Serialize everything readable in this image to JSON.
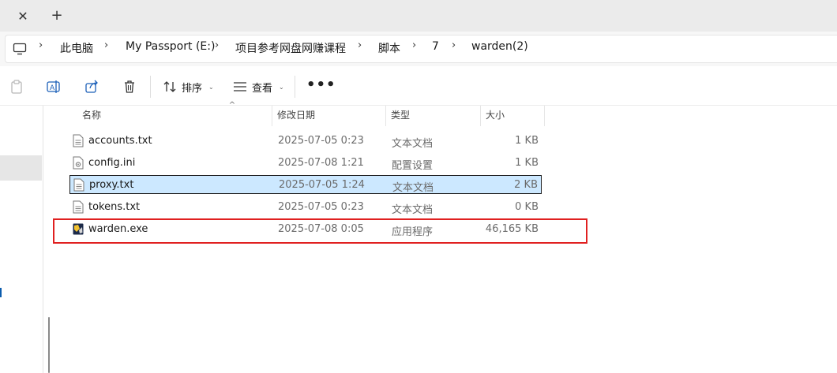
{
  "tabstrip": {
    "close_glyph": "✕",
    "new_tab_glyph": "+"
  },
  "breadcrumb": {
    "items": [
      "此电脑",
      "My Passport (E:)",
      "项目参考网盘网赚课程",
      "脚本",
      "7",
      "warden(2)"
    ]
  },
  "toolbar": {
    "sort_label": "排序",
    "view_label": "查看",
    "more_label": "•••"
  },
  "columns": {
    "name": "名称",
    "date": "修改日期",
    "type": "类型",
    "size": "大小",
    "sort_indicator": "^"
  },
  "files": [
    {
      "name": "accounts.txt",
      "date": "2025-07-05 0:23",
      "type": "文本文档",
      "size": "1 KB",
      "icon": "text-file-icon"
    },
    {
      "name": "config.ini",
      "date": "2025-07-08 1:21",
      "type": "配置设置",
      "size": "1 KB",
      "icon": "settings-file-icon"
    },
    {
      "name": "proxy.txt",
      "date": "2025-07-05 1:24",
      "type": "文本文档",
      "size": "2 KB",
      "icon": "text-file-icon",
      "selected": true
    },
    {
      "name": "tokens.txt",
      "date": "2025-07-05 0:23",
      "type": "文本文档",
      "size": "0 KB",
      "icon": "text-file-icon"
    },
    {
      "name": "warden.exe",
      "date": "2025-07-08 0:05",
      "type": "应用程序",
      "size": "46,165 KB",
      "icon": "application-icon",
      "highlighted": true
    }
  ],
  "colors": {
    "selection_bg": "#cce8ff",
    "highlight_border": "#e02020"
  }
}
